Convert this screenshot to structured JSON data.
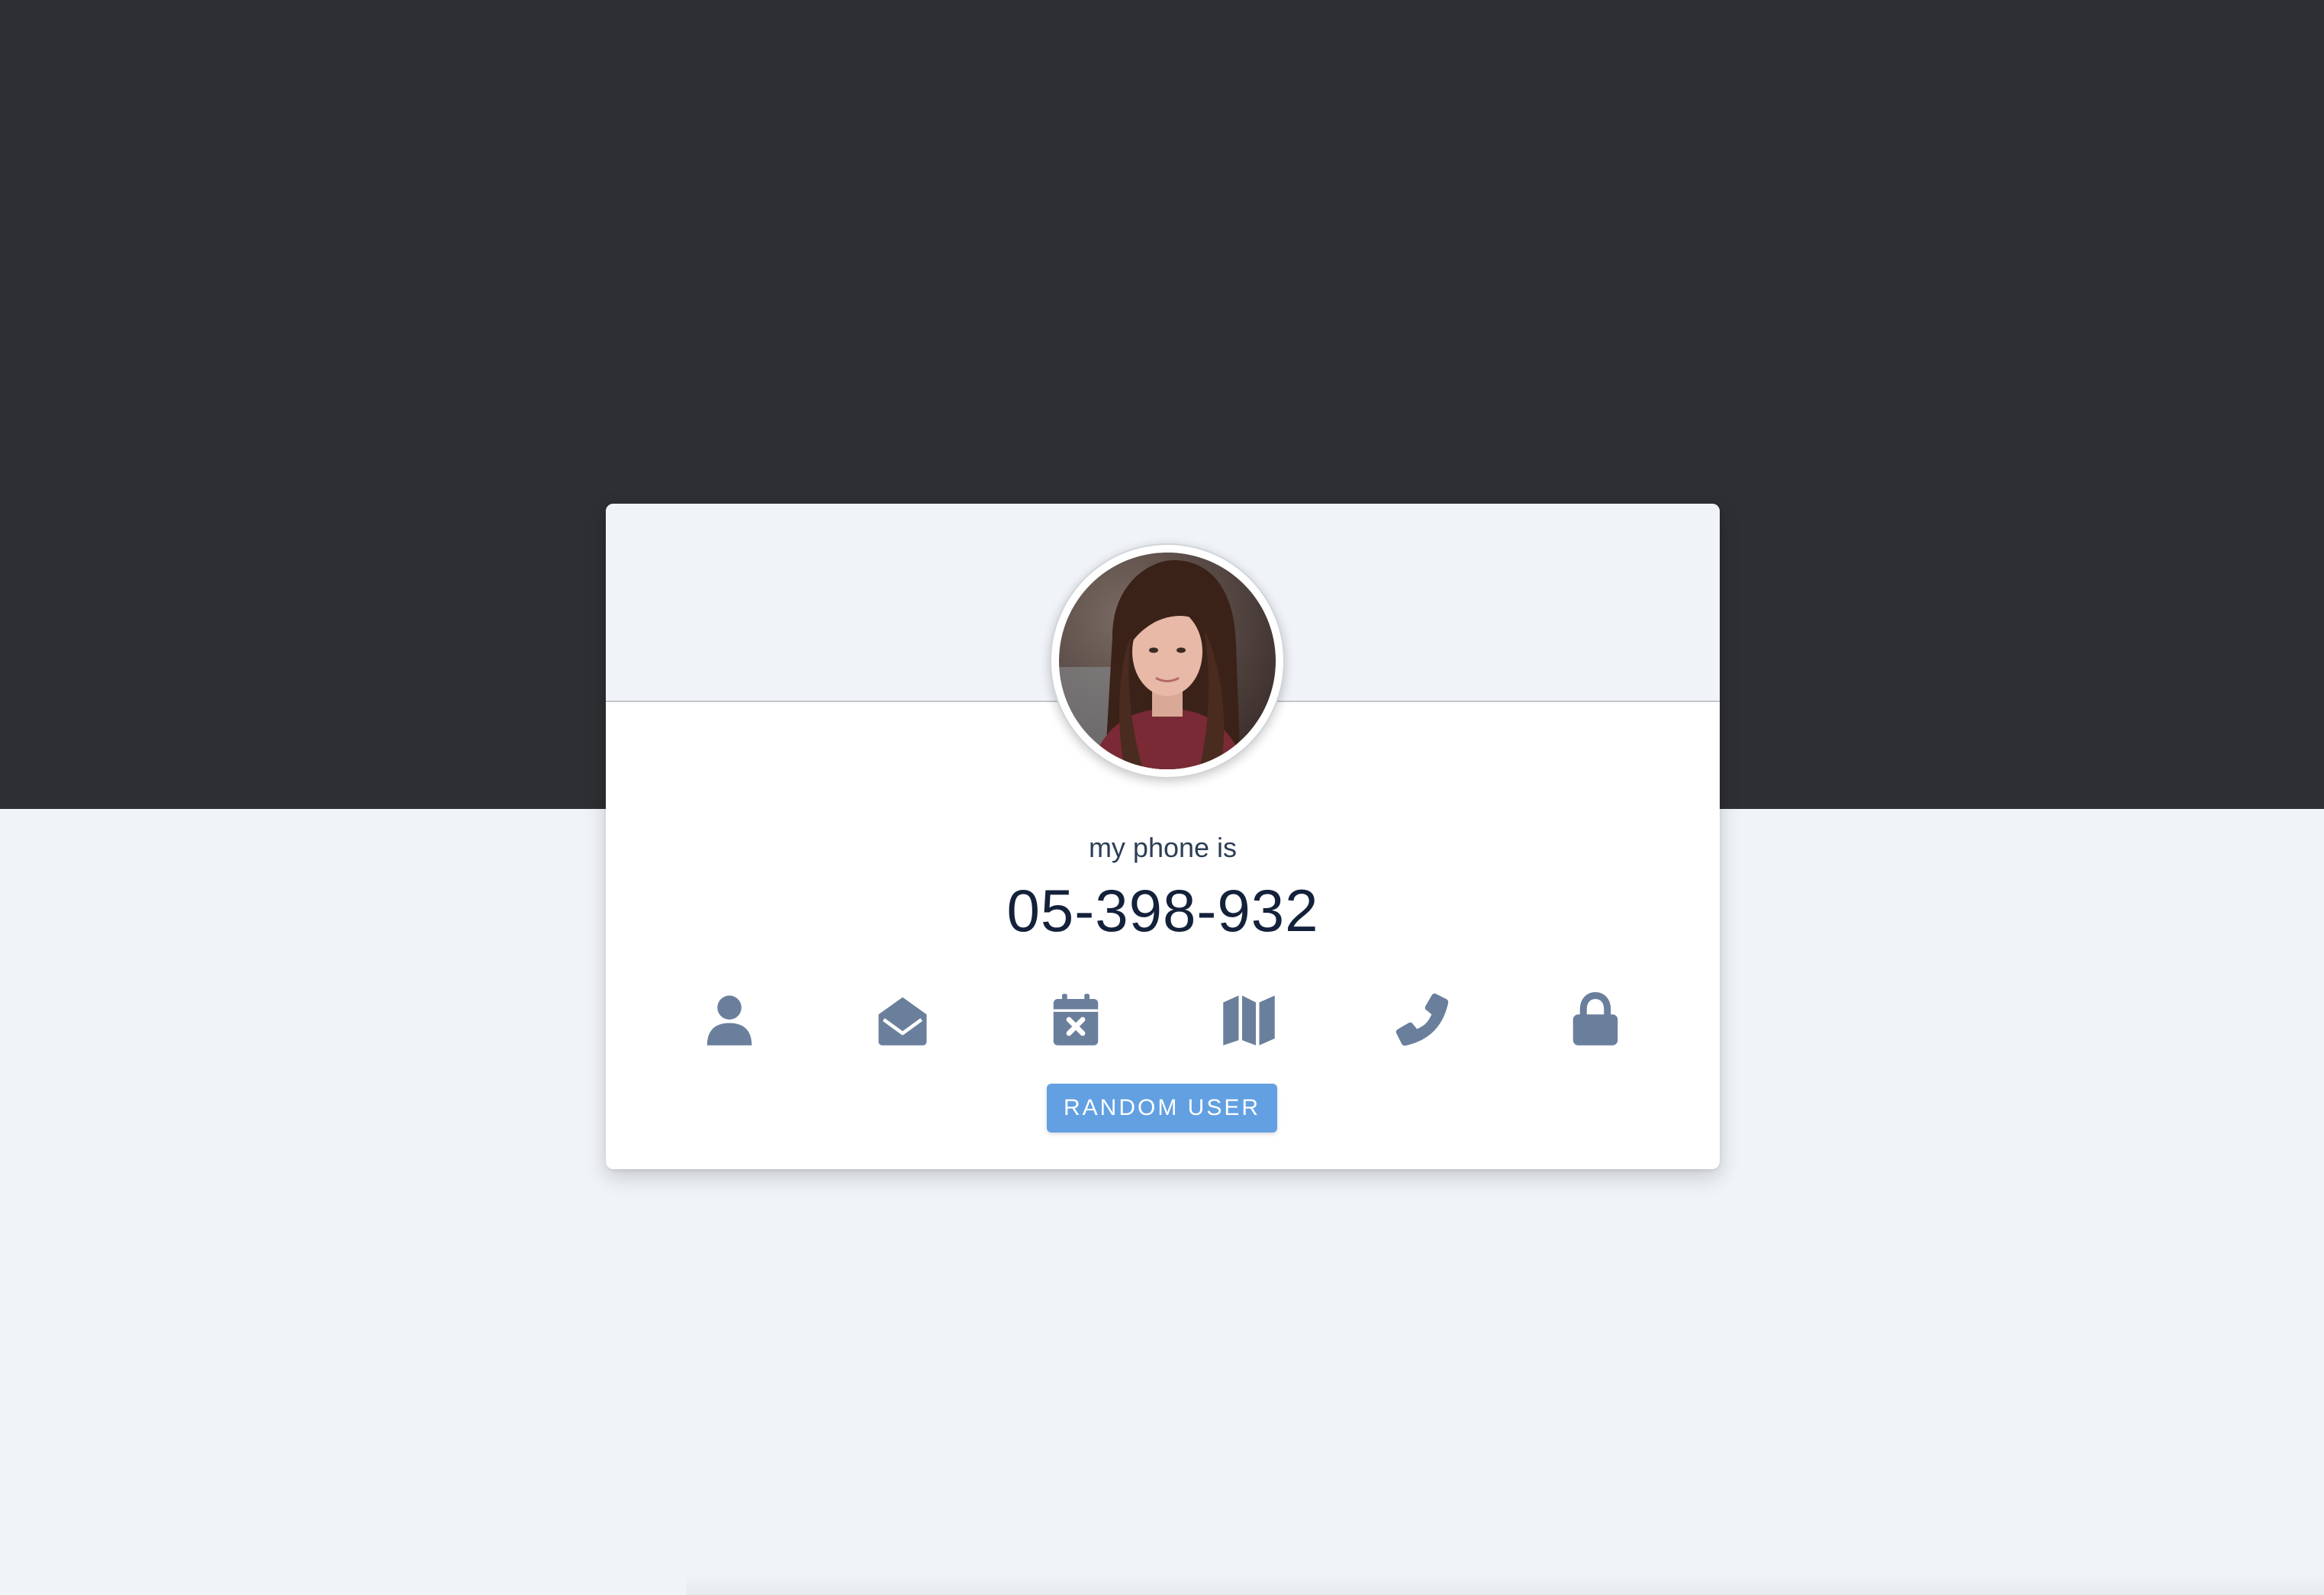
{
  "user_card": {
    "label": "my phone is",
    "value": "05-398-932",
    "avatar_alt": "user-photo"
  },
  "icons": [
    {
      "name": "user-icon"
    },
    {
      "name": "envelope-open-icon"
    },
    {
      "name": "calendar-x-icon"
    },
    {
      "name": "map-icon"
    },
    {
      "name": "phone-icon"
    },
    {
      "name": "lock-icon"
    }
  ],
  "actions": {
    "random_user_label": "RANDOM USER"
  },
  "colors": {
    "top_band": "#2e2f33",
    "page_background": "#f0f4f8",
    "icon": "#6a7f9c",
    "button": "#62a0e2",
    "value_text": "#14213a"
  }
}
